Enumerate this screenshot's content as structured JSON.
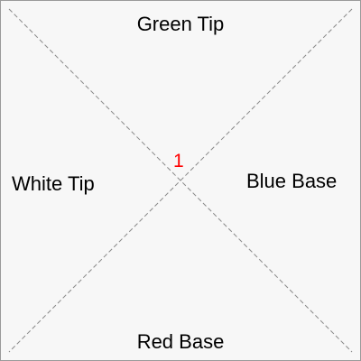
{
  "diagram": {
    "labels": {
      "top": "Green Tip",
      "bottom": "Red Base",
      "left": "White Tip",
      "right": "Blue Base"
    },
    "center_marker": "1",
    "colors": {
      "background": "#f7f7f7",
      "border": "#9a9a9a",
      "diagonal_lines": "#888888",
      "label_text": "#000000",
      "center_marker": "#ff0000"
    },
    "line_style": "dashed"
  }
}
